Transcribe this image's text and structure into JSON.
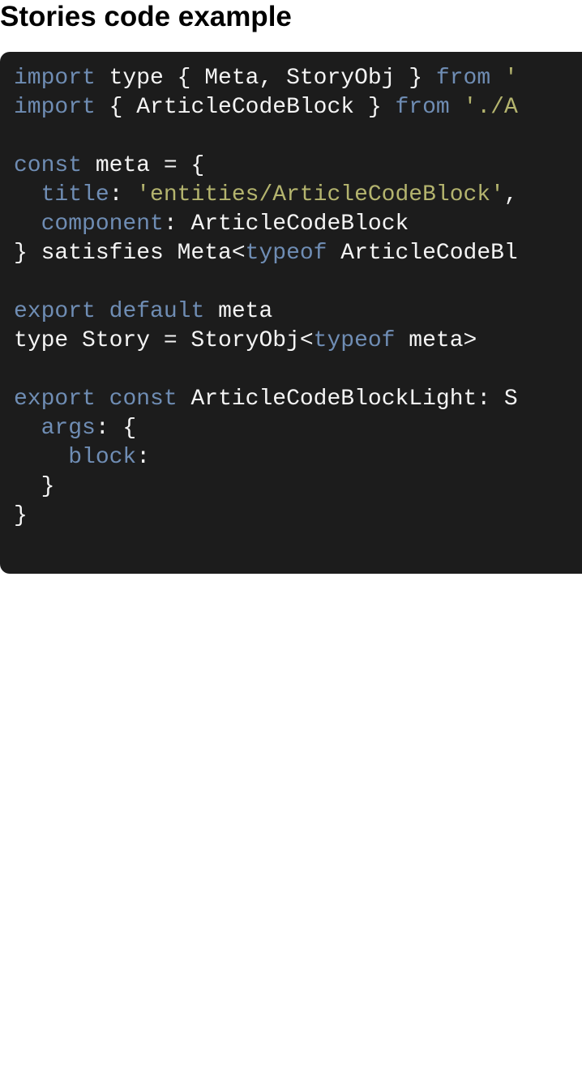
{
  "page": {
    "title": "Stories code example"
  },
  "code": {
    "language": "typescript",
    "colors": {
      "background": "#1c1c1c",
      "keyword": "#6f8db4",
      "string": "#b4b46e",
      "text": "#f4f4f4"
    },
    "lines": [
      [
        {
          "t": "import",
          "k": "kw"
        },
        {
          "t": " type { Meta, StoryObj } ",
          "k": "plain"
        },
        {
          "t": "from",
          "k": "kw"
        },
        {
          "t": " ",
          "k": "plain"
        },
        {
          "t": "'",
          "k": "str"
        }
      ],
      [
        {
          "t": "import",
          "k": "kw"
        },
        {
          "t": " { ArticleCodeBlock } ",
          "k": "plain"
        },
        {
          "t": "from",
          "k": "kw"
        },
        {
          "t": " ",
          "k": "plain"
        },
        {
          "t": "'./A",
          "k": "str"
        }
      ],
      [],
      [
        {
          "t": "const",
          "k": "kw"
        },
        {
          "t": " meta = {",
          "k": "plain"
        }
      ],
      [
        {
          "t": "  ",
          "k": "plain"
        },
        {
          "t": "title",
          "k": "kw"
        },
        {
          "t": ": ",
          "k": "plain"
        },
        {
          "t": "'entities/ArticleCodeBlock'",
          "k": "str"
        },
        {
          "t": ",",
          "k": "plain"
        }
      ],
      [
        {
          "t": "  ",
          "k": "plain"
        },
        {
          "t": "component",
          "k": "kw"
        },
        {
          "t": ": ArticleCodeBlock",
          "k": "plain"
        }
      ],
      [
        {
          "t": "} satisfies Meta<",
          "k": "plain"
        },
        {
          "t": "typeof",
          "k": "kw"
        },
        {
          "t": " ArticleCodeBl",
          "k": "plain"
        }
      ],
      [],
      [
        {
          "t": "export",
          "k": "kw"
        },
        {
          "t": " ",
          "k": "plain"
        },
        {
          "t": "default",
          "k": "kw"
        },
        {
          "t": " meta",
          "k": "plain"
        }
      ],
      [
        {
          "t": "type Story = StoryObj<",
          "k": "plain"
        },
        {
          "t": "typeof",
          "k": "kw"
        },
        {
          "t": " meta>",
          "k": "plain"
        }
      ],
      [],
      [
        {
          "t": "export",
          "k": "kw"
        },
        {
          "t": " ",
          "k": "plain"
        },
        {
          "t": "const",
          "k": "kw"
        },
        {
          "t": " ArticleCodeBlockLight: S",
          "k": "plain"
        }
      ],
      [
        {
          "t": "  ",
          "k": "plain"
        },
        {
          "t": "args",
          "k": "kw"
        },
        {
          "t": ": {",
          "k": "plain"
        }
      ],
      [
        {
          "t": "    ",
          "k": "plain"
        },
        {
          "t": "block",
          "k": "kw"
        },
        {
          "t": ":",
          "k": "plain"
        }
      ],
      [
        {
          "t": "  }",
          "k": "plain"
        }
      ],
      [
        {
          "t": "}",
          "k": "plain"
        }
      ]
    ]
  }
}
